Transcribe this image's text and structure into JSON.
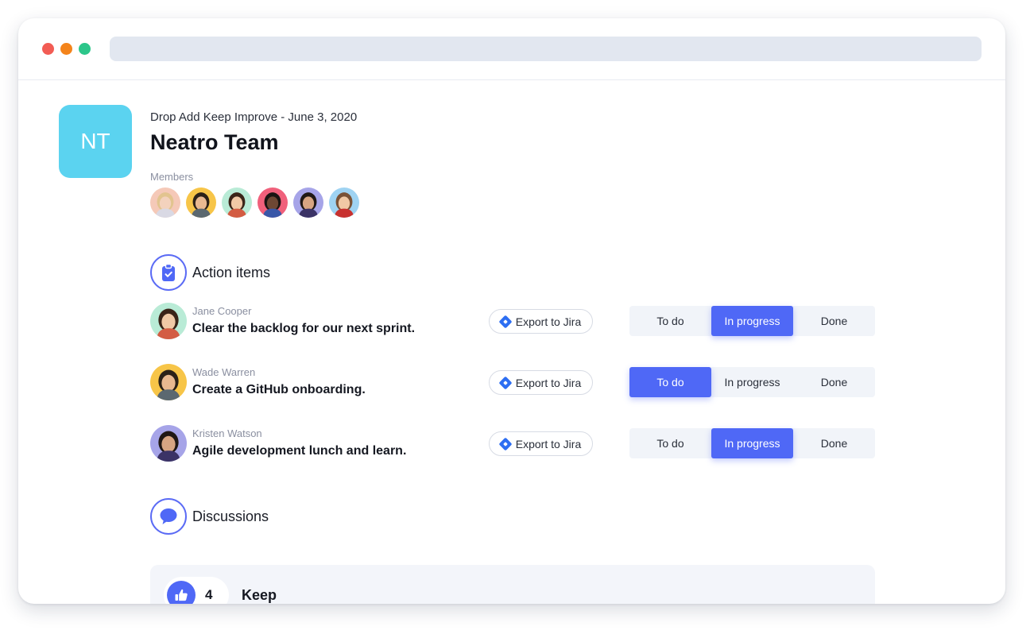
{
  "window": {
    "traffic_lights": [
      "close",
      "minimize",
      "maximize"
    ],
    "address_bar_value": ""
  },
  "team": {
    "initials": "NT",
    "avatar_color": "#5bd3f0",
    "subtitle": "Drop Add Keep Improve - June 3, 2020",
    "name": "Neatro Team"
  },
  "members": {
    "label": "Members",
    "avatars": [
      {
        "bg": "#f5c9b8",
        "hair": "#e2c48f",
        "skin": "#f3d2bd",
        "shirt": "#d9d9e4"
      },
      {
        "bg": "#f7c548",
        "hair": "#2b2118",
        "skin": "#e8b890",
        "shirt": "#5b6870"
      },
      {
        "bg": "#b9ebd6",
        "hair": "#3a2418",
        "skin": "#f0c9a6",
        "shirt": "#d35c43"
      },
      {
        "bg": "#f0607b",
        "hair": "#1a1412",
        "skin": "#6e4733",
        "shirt": "#3957a8"
      },
      {
        "bg": "#a6a4e8",
        "hair": "#201814",
        "skin": "#d7a582",
        "shirt": "#3b3366"
      },
      {
        "bg": "#9fd3f2",
        "hair": "#7a5236",
        "skin": "#f1c9a5",
        "shirt": "#c8312f"
      }
    ]
  },
  "action_items": {
    "label": "Action items",
    "icon": "clipboard-check-icon",
    "statuses": [
      "To do",
      "In progress",
      "Done"
    ],
    "items": [
      {
        "assignee": "Jane Cooper",
        "task": "Clear the backlog for our next sprint.",
        "export_label": "Export to Jira",
        "status": "In progress",
        "avatar": {
          "bg": "#b9ebd6",
          "hair": "#3a2418",
          "skin": "#f0c9a6",
          "shirt": "#d35c43"
        }
      },
      {
        "assignee": "Wade Warren",
        "task": "Create a GitHub onboarding.",
        "export_label": "Export to Jira",
        "status": "To do",
        "avatar": {
          "bg": "#f7c548",
          "hair": "#2b2118",
          "skin": "#e8b890",
          "shirt": "#5b6870"
        }
      },
      {
        "assignee": "Kristen Watson",
        "task": "Agile development lunch and learn.",
        "export_label": "Export to Jira",
        "status": "In progress",
        "avatar": {
          "bg": "#a6a4e8",
          "hair": "#201814",
          "skin": "#d7a582",
          "shirt": "#3b3366"
        }
      }
    ]
  },
  "discussions": {
    "label": "Discussions",
    "icon": "speech-bubble-icon",
    "cards": [
      {
        "title": "Keep",
        "votes": "4",
        "icon": "thumbs-up-icon"
      }
    ]
  },
  "colors": {
    "accent": "#4f68f6",
    "jira": "#2d6ef2",
    "status_track": "#f1f4f9",
    "card_bg": "#f3f5fa"
  }
}
